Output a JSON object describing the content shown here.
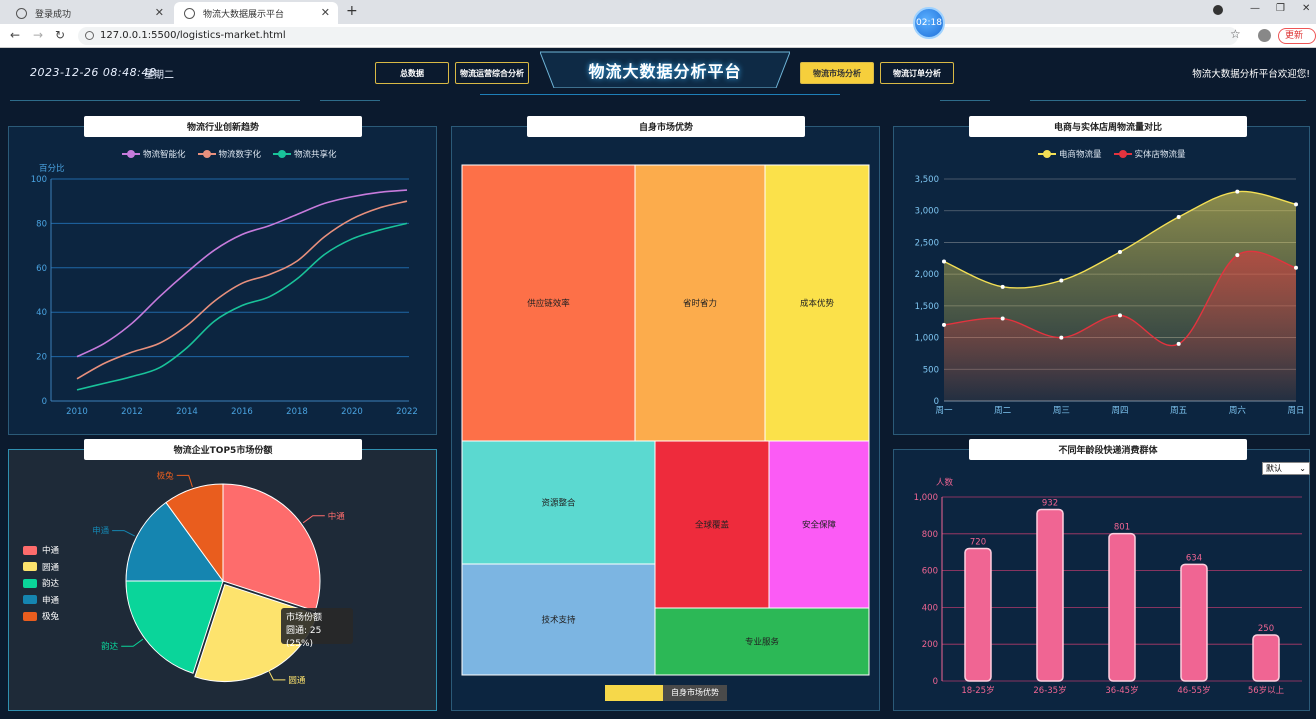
{
  "browser": {
    "tabs": [
      {
        "label": "登录成功"
      },
      {
        "label": "物流大数据展示平台"
      }
    ],
    "url": "127.0.0.1:5500/logistics-market.html",
    "clock": "02:18",
    "update_label": "更新"
  },
  "header": {
    "datetime": "2023-12-26  08:48:48",
    "weekday": "星期二",
    "title": "物流大数据分析平台",
    "welcome": "物流大数据分析平台欢迎您!",
    "nav": [
      {
        "label": "总数据",
        "active": false
      },
      {
        "label": "物流运营综合分析",
        "active": false
      },
      {
        "label": "物流市场分析",
        "active": true
      },
      {
        "label": "物流订单分析",
        "active": false
      }
    ]
  },
  "panels": {
    "trend": "物流行业创新趋势",
    "market": "自身市场优势",
    "compare": "电商与实体店周物流量对比",
    "share": "物流企业TOP5市场份额",
    "age": "不同年龄段快递消费群体"
  },
  "tooltip": {
    "title": "市场份额",
    "text": "圆通: 25 (25%)"
  },
  "age_select": "默认",
  "breadcrumb": "自身市场优势",
  "chart_data": [
    {
      "type": "line",
      "title": "物流行业创新趋势",
      "ylabel": "百分比",
      "x": [
        2010,
        2011,
        2012,
        2013,
        2014,
        2015,
        2016,
        2017,
        2018,
        2019,
        2020,
        2021,
        2022
      ],
      "xticks": [
        2010,
        2012,
        2014,
        2016,
        2018,
        2020,
        2022
      ],
      "ylim": [
        0,
        100
      ],
      "yticks": [
        0,
        20,
        40,
        60,
        80,
        100
      ],
      "series": [
        {
          "name": "物流智能化",
          "color": "#c77bdc",
          "values": [
            20,
            26,
            35,
            47,
            58,
            68,
            75,
            79,
            84,
            89,
            92,
            94,
            95
          ]
        },
        {
          "name": "物流数字化",
          "color": "#e8907d",
          "values": [
            10,
            17,
            22,
            26,
            34,
            45,
            53,
            57,
            63,
            74,
            82,
            87,
            90
          ]
        },
        {
          "name": "物流共享化",
          "color": "#19c39a",
          "values": [
            5,
            8,
            11,
            15,
            24,
            36,
            43,
            47,
            55,
            66,
            73,
            77,
            80
          ]
        }
      ]
    },
    {
      "type": "treemap",
      "title": "自身市场优势",
      "items": [
        {
          "name": "供应链效率",
          "color": "#fd7048"
        },
        {
          "name": "省时省力",
          "color": "#fcac4c"
        },
        {
          "name": "成本优势",
          "color": "#fbe14a"
        },
        {
          "name": "资源整合",
          "color": "#5bd9d0"
        },
        {
          "name": "全球覆盖",
          "color": "#ee2b3c"
        },
        {
          "name": "安全保障",
          "color": "#fb5bf5"
        },
        {
          "name": "技术支持",
          "color": "#7cb5e2"
        },
        {
          "name": "专业服务",
          "color": "#2cb856"
        }
      ]
    },
    {
      "type": "area",
      "title": "电商与实体店周物流量对比",
      "categories": [
        "周一",
        "周二",
        "周三",
        "周四",
        "周五",
        "周六",
        "周日"
      ],
      "ylim": [
        0,
        3500
      ],
      "yticks": [
        0,
        500,
        1000,
        1500,
        2000,
        2500,
        3000,
        3500
      ],
      "series": [
        {
          "name": "电商物流量",
          "color": "#f3df55",
          "values": [
            2200,
            1800,
            1900,
            2350,
            2900,
            3300,
            3100
          ]
        },
        {
          "name": "实体店物流量",
          "color": "#e3333e",
          "values": [
            1200,
            1300,
            1000,
            1350,
            900,
            2300,
            2100
          ]
        }
      ]
    },
    {
      "type": "pie",
      "title": "物流企业TOP5市场份额",
      "slices": [
        {
          "name": "中通",
          "value": 30,
          "color": "#fe6c6c"
        },
        {
          "name": "圆通",
          "value": 25,
          "color": "#fde36d"
        },
        {
          "name": "韵达",
          "value": 20,
          "color": "#0ad59a"
        },
        {
          "name": "申通",
          "value": 15,
          "color": "#1585b0"
        },
        {
          "name": "极兔",
          "value": 10,
          "color": "#e95d1e"
        }
      ]
    },
    {
      "type": "bar",
      "title": "不同年龄段快递消费群体",
      "ylabel": "人数",
      "categories": [
        "18-25岁",
        "26-35岁",
        "36-45岁",
        "46-55岁",
        "56岁以上"
      ],
      "values": [
        720,
        932,
        801,
        634,
        250
      ],
      "ylim": [
        0,
        1000
      ],
      "yticks": [
        0,
        200,
        400,
        600,
        800,
        1000
      ],
      "color": "#f06593"
    }
  ]
}
